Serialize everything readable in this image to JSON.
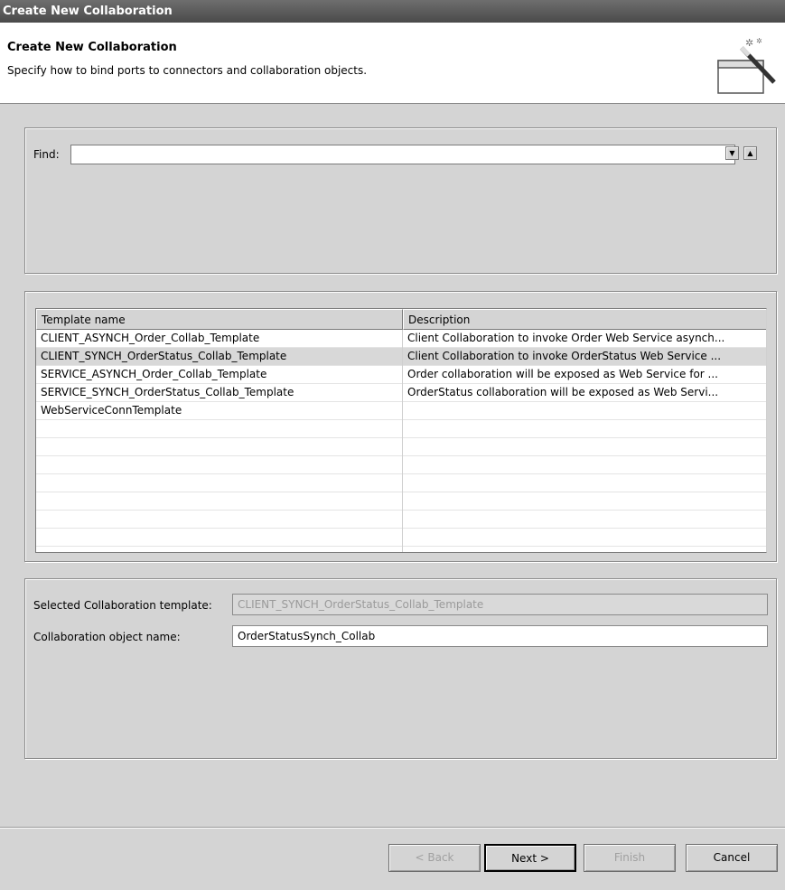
{
  "window": {
    "title": "Create New Collaboration"
  },
  "header": {
    "title": "Create New Collaboration",
    "description": "Specify how to bind ports to connectors and collaboration objects."
  },
  "find": {
    "label": "Find:",
    "value": ""
  },
  "table": {
    "columns": [
      "Template name",
      "Description"
    ],
    "rows": [
      [
        "CLIENT_ASYNCH_Order_Collab_Template",
        "Client Collaboration to invoke Order Web Service asynch..."
      ],
      [
        "CLIENT_SYNCH_OrderStatus_Collab_Template",
        "Client Collaboration to invoke OrderStatus Web Service ..."
      ],
      [
        "SERVICE_ASYNCH_Order_Collab_Template",
        "Order collaboration will be exposed as Web Service for ..."
      ],
      [
        "SERVICE_SYNCH_OrderStatus_Collab_Template",
        "OrderStatus collaboration will be exposed as Web Servi..."
      ],
      [
        "WebServiceConnTemplate",
        ""
      ]
    ],
    "selected_index": 1
  },
  "selection": {
    "template_label": "Selected Collaboration template:",
    "template_value": "CLIENT_SYNCH_OrderStatus_Collab_Template",
    "object_label": "Collaboration object name:",
    "object_value": "OrderStatusSynch_Collab"
  },
  "buttons": {
    "back": "< Back",
    "next": "Next >",
    "finish": "Finish",
    "cancel": "Cancel"
  },
  "icons": {
    "header": "wizard-wand-icon",
    "down": "arrow-down-icon",
    "up": "arrow-up-icon"
  }
}
